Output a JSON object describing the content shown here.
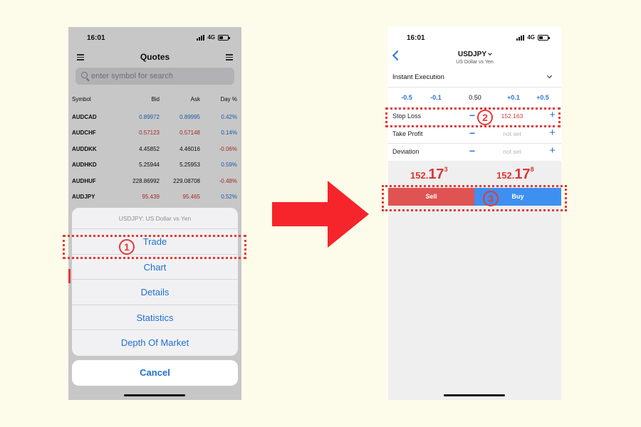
{
  "left_phone": {
    "status": {
      "time": "16:01",
      "network": "4G"
    },
    "header": {
      "title": "Quotes"
    },
    "search": {
      "placeholder": "enter symbol for search"
    },
    "columns": {
      "symbol": "Symbol",
      "bid": "Bid",
      "ask": "Ask",
      "day": "Day %"
    },
    "rows": [
      {
        "symbol": "AUDCAD",
        "bid": "0.89972",
        "ask": "0.89995",
        "day": "0.42%",
        "color": "blue"
      },
      {
        "symbol": "AUDCHF",
        "bid": "0.57123",
        "ask": "0.57148",
        "day": "0.14%",
        "color": "red"
      },
      {
        "symbol": "AUDDKK",
        "bid": "4.45852",
        "ask": "4.46016",
        "day": "-0.06%",
        "color": "black"
      },
      {
        "symbol": "AUDHKD",
        "bid": "5.25944",
        "ask": "5.25953",
        "day": "0.59%",
        "color": "black"
      },
      {
        "symbol": "AUDHUF",
        "bid": "228.86992",
        "ask": "229.08708",
        "day": "-0.48%",
        "color": "black"
      },
      {
        "symbol": "AUDJPY",
        "bid": "95.439",
        "ask": "95.465",
        "day": "0.52%",
        "color": "red"
      }
    ],
    "action_sheet": {
      "title": "USDJPY: US Dollar vs Yen",
      "items": [
        "Trade",
        "Chart",
        "Details",
        "Statistics",
        "Depth Of Market"
      ],
      "cancel": "Cancel"
    }
  },
  "right_phone": {
    "status": {
      "time": "16:01",
      "network": "4G"
    },
    "header": {
      "symbol": "USDJPY",
      "subtitle": "US Dollar vs Yen"
    },
    "execution": "Instant Execution",
    "volume_steps": [
      "-0.5",
      "-0.1",
      "0.50",
      "+0.1",
      "+0.5"
    ],
    "params": [
      {
        "label": "Stop Loss",
        "value": "152.163"
      },
      {
        "label": "Take Profit",
        "value": "not set"
      },
      {
        "label": "Deviation",
        "value": "not set"
      }
    ],
    "sell_price": {
      "small": "152.",
      "big": "17",
      "sup": "3"
    },
    "buy_price": {
      "small": "152.",
      "big": "17",
      "sup": "8"
    },
    "sell_label": "Sell",
    "buy_label": "Buy"
  },
  "annotations": {
    "step1": "1",
    "step2": "2",
    "step3": "3"
  },
  "colors": {
    "sell": "#e05353",
    "buy": "#3d8ff0",
    "highlight": "#e53935",
    "link": "#1f6fd0"
  }
}
